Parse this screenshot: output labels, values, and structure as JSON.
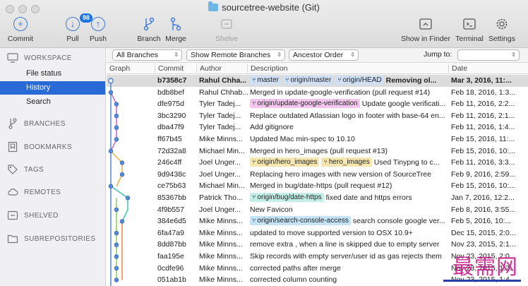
{
  "window": {
    "title": "sourcetree-website (Git)"
  },
  "toolbar": {
    "commit": "Commit",
    "pull": "Pull",
    "pull_badge": "98",
    "push": "Push",
    "branch": "Branch",
    "merge": "Merge",
    "shelve": "Shelve",
    "show_in_finder": "Show in Finder",
    "terminal": "Terminal",
    "settings": "Settings"
  },
  "sidebar": {
    "workspace": "WORKSPACE",
    "items": [
      "File status",
      "History",
      "Search"
    ],
    "active_item": "History",
    "sections": [
      "BRANCHES",
      "BOOKMARKS",
      "TAGS",
      "REMOTES",
      "SHELVED",
      "SUBREPOSITORIES"
    ]
  },
  "filters": {
    "branches": "All Branches",
    "remote": "Show Remote Branches",
    "order": "Ancestor Order",
    "jump_to": "Jump to:"
  },
  "table": {
    "headers": [
      "Graph",
      "Commit",
      "Author",
      "Description",
      "Date"
    ],
    "rows": [
      {
        "commit": "b7358c7",
        "author": "Rahul Chha...",
        "tags": [
          [
            "master",
            "#cfe0f5"
          ],
          [
            "origin/master",
            "#cfe0f5"
          ],
          [
            "origin/HEAD",
            "#cfe0f5"
          ]
        ],
        "desc": "Removing ol...",
        "date": "Mar 3, 2016, 11:..."
      },
      {
        "commit": "bdb8bef",
        "author": "Rahul Chhab...",
        "tags": [],
        "desc": "Merged in update-google-verification (pull request #14)",
        "date": "Feb 18, 2016, 1:3..."
      },
      {
        "commit": "dfe975d",
        "author": "Tyler Tadej...",
        "tags": [
          [
            "origin/update-google-verification",
            "#f4c6ef"
          ]
        ],
        "desc": "Update google verificati...",
        "date": "Feb 11, 2016, 2:2..."
      },
      {
        "commit": "3bc3290",
        "author": "Tyler Tadej...",
        "tags": [],
        "desc": "Replace outdated Atlassian logo in footer with base-64 en...",
        "date": "Feb 11, 2016, 2:1..."
      },
      {
        "commit": "dba47f9",
        "author": "Tyler Tadej...",
        "tags": [],
        "desc": "Add gitignore",
        "date": "Feb 11, 2016, 1:4..."
      },
      {
        "commit": "ff67b45",
        "author": "Mike Minns...",
        "tags": [],
        "desc": "Updated Mac min-spec to 10.10",
        "date": "Feb 15, 2016, 11:..."
      },
      {
        "commit": "72d32a8",
        "author": "Michael Min...",
        "tags": [],
        "desc": "Merged in hero_images (pull request #13)",
        "date": "Feb 15, 2016, 10:..."
      },
      {
        "commit": "246c4ff",
        "author": "Joel Unger...",
        "tags": [
          [
            "origin/hero_images",
            "#f6e7b0"
          ],
          [
            "hero_images",
            "#f6e7b0"
          ]
        ],
        "desc": "Used Tinypng to c...",
        "date": "Feb 11, 2016, 3:3..."
      },
      {
        "commit": "9d9438c",
        "author": "Joel Unger...",
        "tags": [],
        "desc": "Replacing hero images with new version of SourceTree",
        "date": "Feb 9, 2016, 2:59..."
      },
      {
        "commit": "ce75b63",
        "author": "Michael Min...",
        "tags": [],
        "desc": "Merged in bug/date-https (pull request #12)",
        "date": "Feb 15, 2016, 10:..."
      },
      {
        "commit": "85367bb",
        "author": "Patrick Tho...",
        "tags": [
          [
            "origin/bug/date-https",
            "#c4efe9"
          ]
        ],
        "desc": "fixed date and https errors",
        "date": "Jan 7, 2016, 12:2..."
      },
      {
        "commit": "4f9b557",
        "author": "Joel Unger...",
        "tags": [],
        "desc": "New Favicon",
        "date": "Feb 8, 2016, 3:55..."
      },
      {
        "commit": "384e6d5",
        "author": "Mike Minns...",
        "tags": [
          [
            "origin/search-console-access",
            "#c4e3f6"
          ]
        ],
        "desc": "search console google ver...",
        "date": "Feb 5, 2016, 10:..."
      },
      {
        "commit": "6fa47a9",
        "author": "Mike Minns...",
        "tags": [],
        "desc": "updated to move supported version to OSX 10.9+",
        "date": "Dec 15, 2015, 2:0..."
      },
      {
        "commit": "8dd87bb",
        "author": "Mike Minns...",
        "tags": [],
        "desc": "remove extra , when a line is skipped due to empty server",
        "date": "Nov 23, 2015, 2:1..."
      },
      {
        "commit": "faa195e",
        "author": "Mike Minns...",
        "tags": [],
        "desc": "Skip records with empty server/user id as gas rejects them",
        "date": "Nov 23, 2015, 2:0..."
      },
      {
        "commit": "0cdfe96",
        "author": "Mike Minns...",
        "tags": [],
        "desc": "corrected paths after merge",
        "date": "Nov 23, 2015, 1:2..."
      },
      {
        "commit": "051ab1b",
        "author": "Mike Minns...",
        "tags": [],
        "desc": "corrected column counting",
        "date": "Nov 23, 2015, 1:4..."
      }
    ]
  },
  "watermark": "最需网"
}
